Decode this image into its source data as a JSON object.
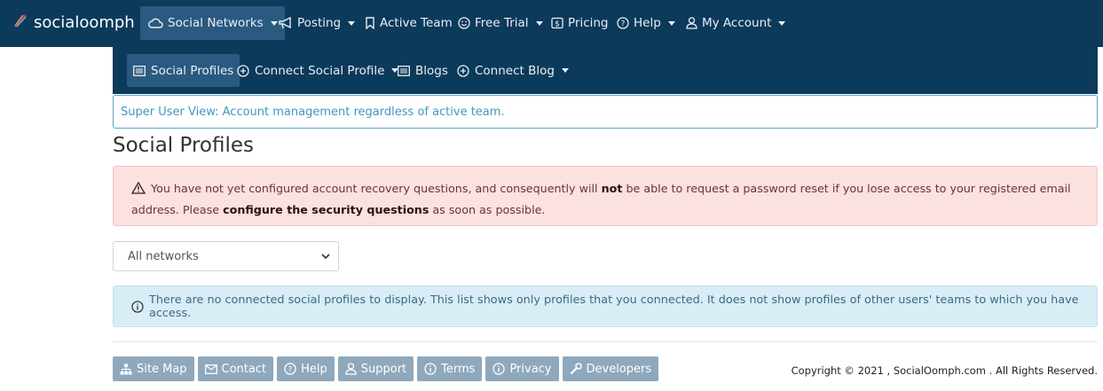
{
  "brand": {
    "name": "socialoomph"
  },
  "topnav": {
    "items": [
      {
        "label": "Social Networks",
        "icon": "cloud-icon",
        "dropdown": true,
        "active": true
      },
      {
        "label": "Posting",
        "icon": "bullhorn-icon",
        "dropdown": true
      },
      {
        "label": "Active Team",
        "icon": "bookmark-icon",
        "dropdown": false
      },
      {
        "label": "Free Trial",
        "icon": "smile-icon",
        "dropdown": true
      },
      {
        "label": "Pricing",
        "icon": "dollar-icon",
        "dropdown": false
      },
      {
        "label": "Help",
        "icon": "question-circle-icon",
        "dropdown": true
      },
      {
        "label": "My Account",
        "icon": "user-icon",
        "dropdown": true
      }
    ]
  },
  "subnav": {
    "items": [
      {
        "label": "Social Profiles",
        "icon": "list-icon",
        "active": true
      },
      {
        "label": "Connect Social Profile",
        "icon": "plus-circle-icon",
        "dropdown": true
      },
      {
        "label": "Blogs",
        "icon": "list-icon"
      },
      {
        "label": "Connect Blog",
        "icon": "plus-circle-icon",
        "dropdown": true
      }
    ]
  },
  "superuser": {
    "text": "Super User View: Account management regardless of active team."
  },
  "page": {
    "title": "Social Profiles"
  },
  "warning": {
    "part1": "You have not yet configured account recovery questions, and consequently will ",
    "bold1": "not",
    "part2": " be able to request a password reset if you lose access to your registered email address. Please ",
    "bold2": "configure the security questions",
    "part3": " as soon as possible."
  },
  "filter": {
    "selected": "All networks"
  },
  "info": {
    "text": "There are no connected social profiles to display. This list shows only profiles that you connected. It does not show profiles of other users' teams to which you have access."
  },
  "footer": {
    "links": [
      {
        "label": "Site Map",
        "icon": "sitemap-icon"
      },
      {
        "label": "Contact",
        "icon": "envelope-icon"
      },
      {
        "label": "Help",
        "icon": "question-circle-icon"
      },
      {
        "label": "Support",
        "icon": "user-icon"
      },
      {
        "label": "Terms",
        "icon": "info-circle-icon"
      },
      {
        "label": "Privacy",
        "icon": "info-circle-icon"
      },
      {
        "label": "Developers",
        "icon": "wrench-icon"
      }
    ],
    "copyright": "Copyright © 2021 , SocialOomph.com . All Rights Reserved."
  },
  "colors": {
    "navbar": "#0b3a5b",
    "navActive": "#2a5a80",
    "footerButton": "#8fa8bb",
    "dangerBg": "#fbe1df",
    "infoBg": "#d9edf6",
    "link": "#3f97c2"
  }
}
